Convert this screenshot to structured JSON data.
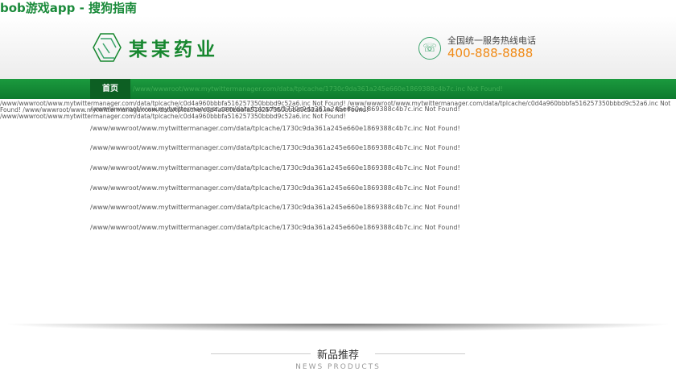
{
  "page_title": "bob游戏app - 搜狗指南",
  "logo_text": "某某药业",
  "phone": {
    "label": "全国统一服务热线电话",
    "number": "400-888-8888"
  },
  "nav": {
    "home": "首页",
    "error": "/www/wwwroot/www.mytwittermanager.com/data/tplcache/1730c9da361a245e660e1869388c4b7c.inc Not Found!"
  },
  "errors_top": [
    "/www/wwwroot/www.mytwittermanager.com/data/tplcache/c0d4a960bbbfa516257350bbbd9c52a6.inc Not Found! /www/wwwroot/www.mytwittermanager.com/data/tplcache/c0d4a960bbbfa516257350bbbd9c52a6.inc Not",
    "Found! /www/wwwroot/www.mytwittermanager.com/data/tplcache/c0d4a960bbbfa516257350bbbd9c52a6.inc Not Found!",
    "/www/wwwroot/www.mytwittermanager.com/data/tplcache/c0d4a960bbbfa516257350bbbd9c52a6.inc Not Found!"
  ],
  "errors_list": [
    "/www/wwwroot/www.mytwittermanager.com/data/tplcache/1730c9da361a245e660e1869388c4b7c.inc Not Found!",
    "/www/wwwroot/www.mytwittermanager.com/data/tplcache/1730c9da361a245e660e1869388c4b7c.inc Not Found!",
    "/www/wwwroot/www.mytwittermanager.com/data/tplcache/1730c9da361a245e660e1869388c4b7c.inc Not Found!",
    "/www/wwwroot/www.mytwittermanager.com/data/tplcache/1730c9da361a245e660e1869388c4b7c.inc Not Found!",
    "/www/wwwroot/www.mytwittermanager.com/data/tplcache/1730c9da361a245e660e1869388c4b7c.inc Not Found!",
    "/www/wwwroot/www.mytwittermanager.com/data/tplcache/1730c9da361a245e660e1869388c4b7c.inc Not Found!",
    "/www/wwwroot/www.mytwittermanager.com/data/tplcache/1730c9da361a245e660e1869388c4b7c.inc Not Found!"
  ],
  "section": {
    "title": "新品推荐",
    "subtitle": "NEWS PRODUCTS"
  }
}
